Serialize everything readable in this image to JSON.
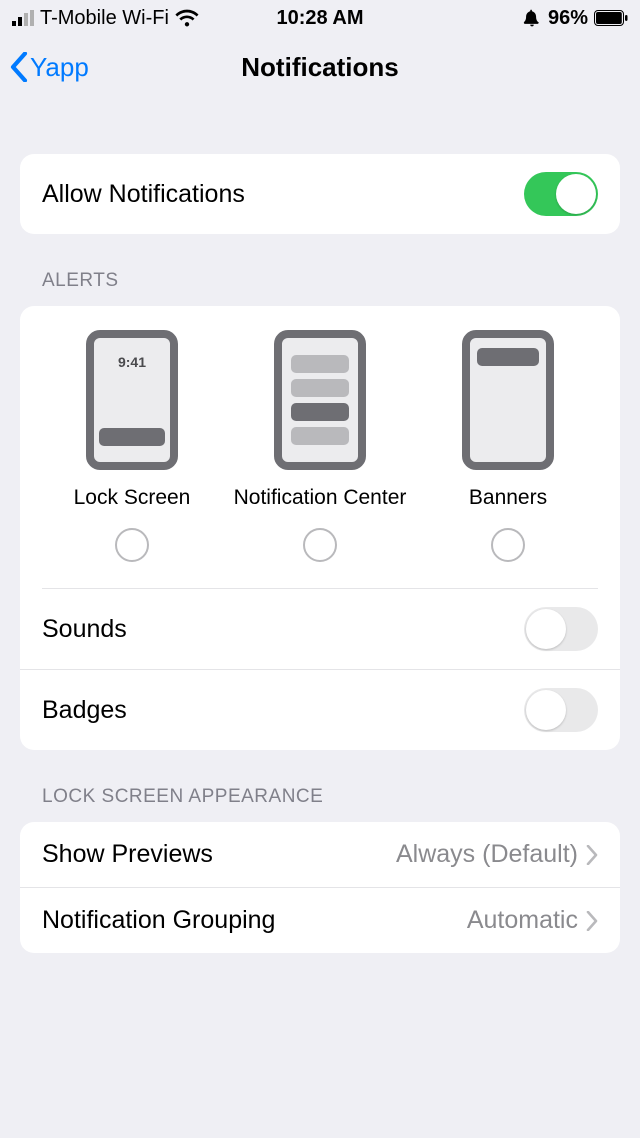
{
  "status": {
    "carrier": "T-Mobile Wi-Fi",
    "time": "10:28 AM",
    "battery": "96%"
  },
  "nav": {
    "back_label": "Yapp",
    "title": "Notifications"
  },
  "allow": {
    "label": "Allow Notifications",
    "on": true
  },
  "sections": {
    "alerts_header": "Alerts",
    "lock_header": "Lock Screen Appearance"
  },
  "alerts": {
    "options": {
      "lock": "Lock Screen",
      "nc": "Notification Center",
      "banner": "Banners"
    },
    "preview_time": "9:41",
    "sounds": {
      "label": "Sounds",
      "on": false
    },
    "badges": {
      "label": "Badges",
      "on": false
    }
  },
  "lockscreen": {
    "previews": {
      "label": "Show Previews",
      "value": "Always (Default)"
    },
    "grouping": {
      "label": "Notification Grouping",
      "value": "Automatic"
    }
  }
}
